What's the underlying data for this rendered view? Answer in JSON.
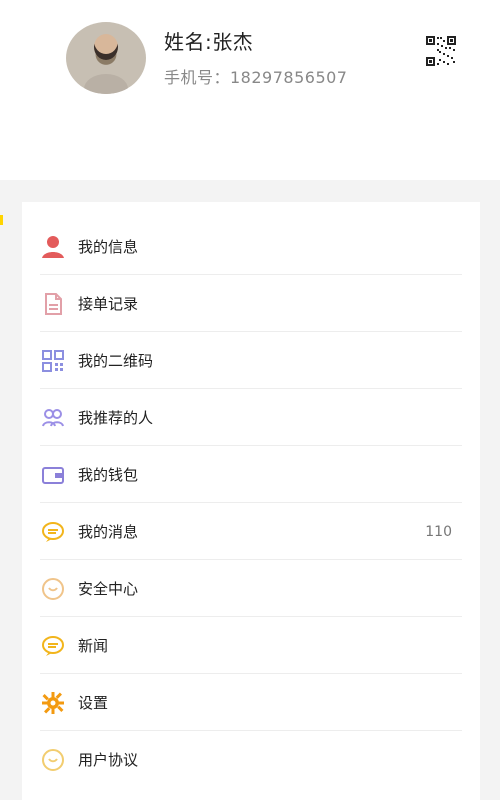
{
  "profile": {
    "name": "姓名:张杰",
    "phone": "手机号：18297856507"
  },
  "menu": [
    {
      "label": "我的信息",
      "icon": "user-icon"
    },
    {
      "label": "接单记录",
      "icon": "document-icon"
    },
    {
      "label": "我的二维码",
      "icon": "qr-code-icon"
    },
    {
      "label": "我推荐的人",
      "icon": "people-icon"
    },
    {
      "label": "我的钱包",
      "icon": "wallet-icon"
    },
    {
      "label": "我的消息",
      "icon": "message-icon",
      "badge": "110"
    },
    {
      "label": "安全中心",
      "icon": "security-icon"
    },
    {
      "label": "新闻",
      "icon": "news-icon"
    },
    {
      "label": "设置",
      "icon": "settings-gear-icon"
    },
    {
      "label": "用户协议",
      "icon": "agreement-icon"
    }
  ],
  "colors": {
    "user": "#e35b5b",
    "doc": "#e2a0a8",
    "qr": "#8c8fe0",
    "people": "#9b8fe6",
    "wallet": "#8b80d9",
    "message": "#f2b51c",
    "security": "#f0c48a",
    "news": "#f2b51c",
    "settings": "#f39a10",
    "agreement": "#f2cd70"
  }
}
